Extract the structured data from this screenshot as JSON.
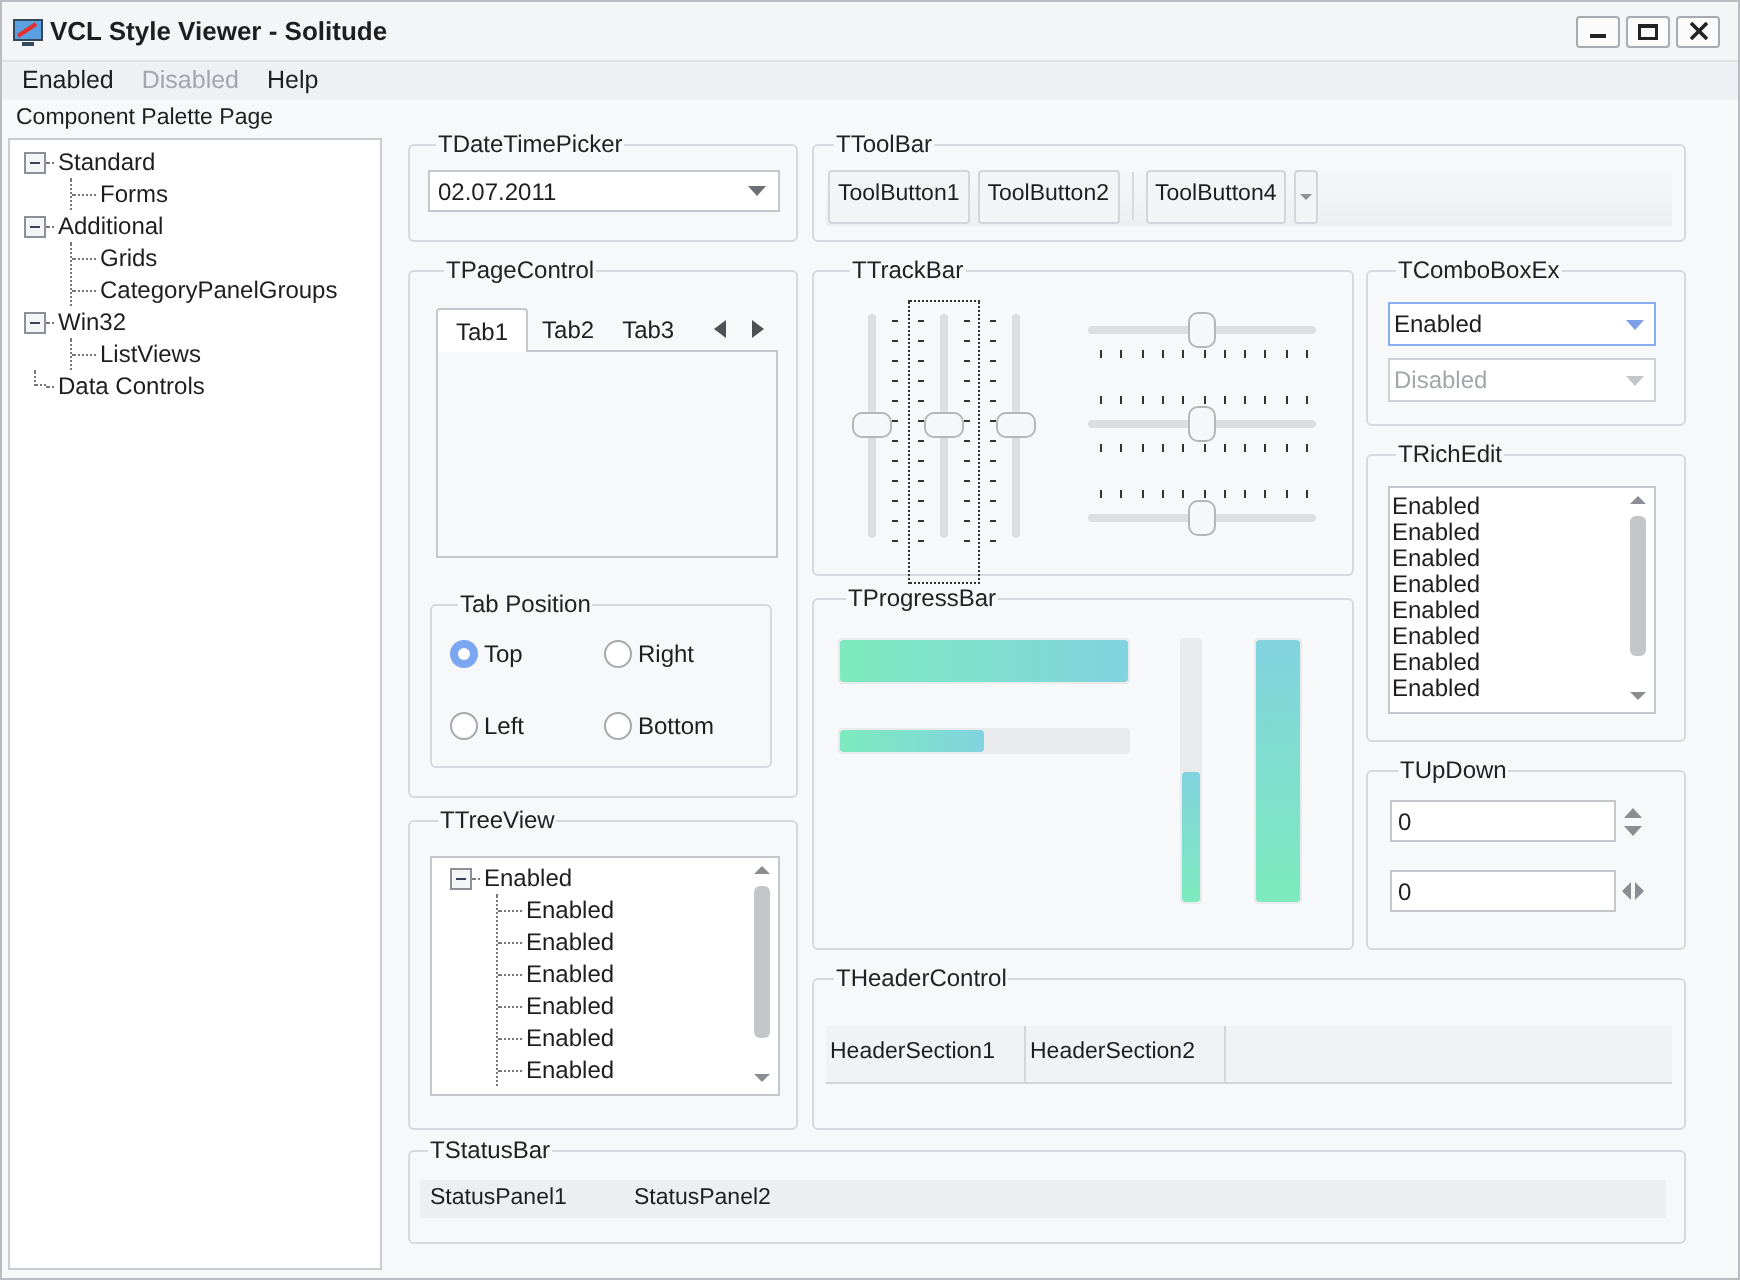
{
  "window": {
    "title": "VCL Style Viewer - Solitude"
  },
  "menu": [
    {
      "label": "Enabled",
      "disabled": false
    },
    {
      "label": "Disabled",
      "disabled": true
    },
    {
      "label": "Help",
      "disabled": false
    }
  ],
  "palette": {
    "label": "Component Palette Page",
    "tree": [
      {
        "label": "Standard",
        "expanded": true,
        "children": [
          {
            "label": "Forms"
          }
        ]
      },
      {
        "label": "Additional",
        "expanded": true,
        "children": [
          {
            "label": "Grids"
          },
          {
            "label": "CategoryPanelGroups"
          }
        ]
      },
      {
        "label": "Win32",
        "expanded": true,
        "children": [
          {
            "label": "ListViews"
          }
        ]
      },
      {
        "label": "Data Controls"
      }
    ]
  },
  "date_time_picker": {
    "title": "TDateTimePicker",
    "value": "02.07.2011"
  },
  "toolbar": {
    "title": "TToolBar",
    "items": [
      {
        "kind": "button",
        "label": "ToolButton1"
      },
      {
        "kind": "button",
        "label": "ToolButton2"
      },
      {
        "kind": "separator"
      },
      {
        "kind": "button",
        "label": "ToolButton4"
      },
      {
        "kind": "dropdown"
      }
    ]
  },
  "page_control": {
    "title": "TPageControl",
    "tabs": [
      {
        "label": "Tab1",
        "selected": true
      },
      {
        "label": "Tab2",
        "selected": false
      },
      {
        "label": "Tab3",
        "selected": false
      }
    ],
    "tab_position": {
      "title": "Tab Position",
      "options": [
        {
          "label": "Top",
          "selected": true
        },
        {
          "label": "Right",
          "selected": false
        },
        {
          "label": "Left",
          "selected": false
        },
        {
          "label": "Bottom",
          "selected": false
        }
      ]
    }
  },
  "tree_view": {
    "title": "TTreeView",
    "items": [
      {
        "label": "Enabled",
        "expanded": true,
        "children": [
          {
            "label": "Enabled"
          },
          {
            "label": "Enabled"
          },
          {
            "label": "Enabled"
          },
          {
            "label": "Enabled"
          },
          {
            "label": "Enabled"
          },
          {
            "label": "Enabled"
          }
        ]
      }
    ]
  },
  "track_bar": {
    "title": "TTrackBar",
    "vertical": [
      {
        "level": 0.5,
        "ticks_before": false,
        "ticks_after": true,
        "focused": false
      },
      {
        "level": 0.5,
        "ticks_before": true,
        "ticks_after": true,
        "focused": true
      },
      {
        "level": 0.5,
        "ticks_before": true,
        "ticks_after": false,
        "focused": false
      }
    ],
    "horizontal": [
      {
        "level": 0.5,
        "ticks_before": false,
        "ticks_after": true
      },
      {
        "level": 0.5,
        "ticks_before": true,
        "ticks_after": true
      },
      {
        "level": 0.5,
        "ticks_before": true,
        "ticks_after": false
      }
    ]
  },
  "progress_bar": {
    "title": "TProgressBar",
    "bars": [
      {
        "vertical": false,
        "thick": true,
        "level": 1
      },
      {
        "vertical": false,
        "thick": false,
        "level": 0.5
      },
      {
        "vertical": true,
        "thick": false,
        "level": 0.5
      },
      {
        "vertical": true,
        "thick": true,
        "level": 1
      }
    ]
  },
  "header_control": {
    "title": "THeaderControl",
    "sections": [
      "HeaderSection1",
      "HeaderSection2"
    ]
  },
  "combo_box_ex": {
    "title": "TComboBoxEx",
    "fields": [
      {
        "value": "Enabled",
        "disabled": false,
        "focused": true
      },
      {
        "value": "Disabled",
        "disabled": true,
        "focused": false
      }
    ]
  },
  "rich_edit": {
    "title": "TRichEdit",
    "lines": [
      "Enabled",
      "Enabled",
      "Enabled",
      "Enabled",
      "Enabled",
      "Enabled",
      "Enabled",
      "Enabled"
    ]
  },
  "up_down": {
    "title": "TUpDown",
    "fields": [
      {
        "value": "0",
        "vertical": true
      },
      {
        "value": "0",
        "vertical": false
      }
    ]
  },
  "status_bar": {
    "title": "TStatusBar",
    "panels": [
      "StatusPanel1",
      "StatusPanel2"
    ]
  }
}
